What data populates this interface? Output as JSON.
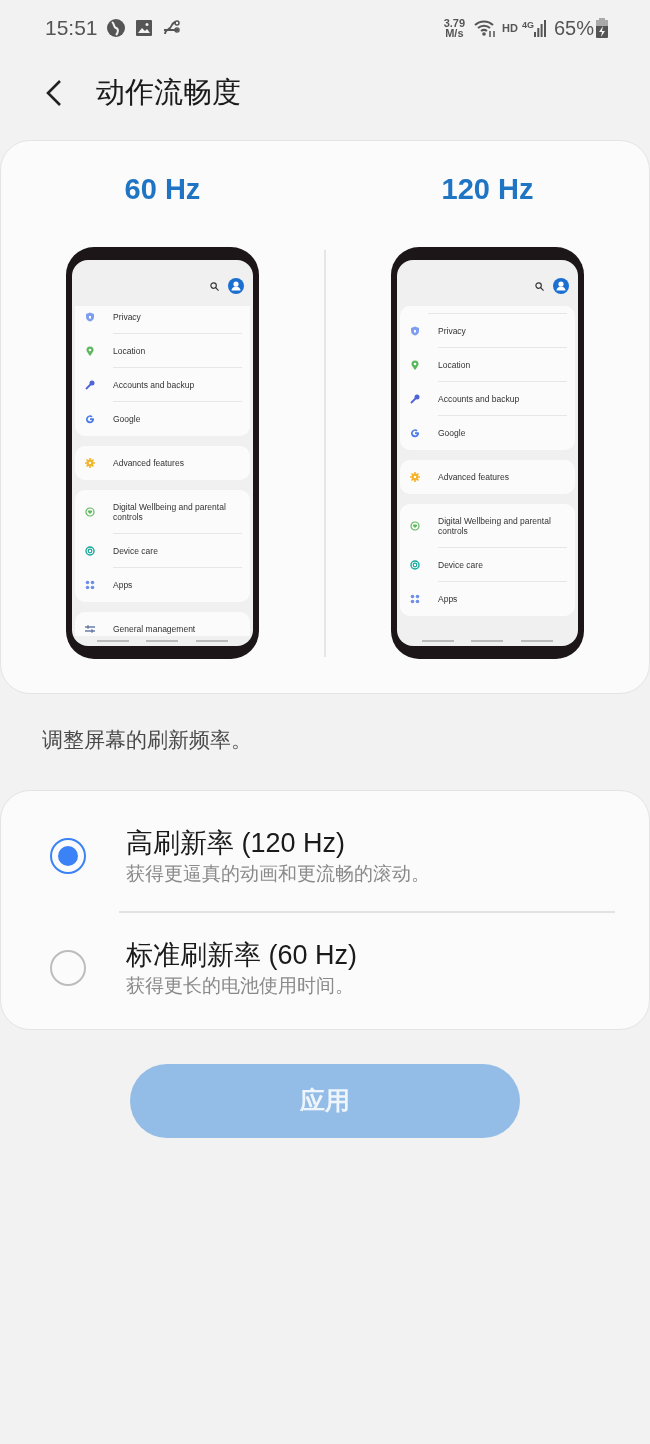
{
  "status_bar": {
    "time": "15:51",
    "speed_value": "3.79",
    "speed_unit": "M/s",
    "hd": "HD",
    "network": "4G",
    "battery": "65%"
  },
  "header": {
    "title": "动作流畅度"
  },
  "previews": [
    {
      "label": "60 Hz",
      "scrolled": true,
      "groups": [
        [
          {
            "kind": "shield",
            "text": "Privacy"
          },
          {
            "kind": "pin",
            "text": "Location"
          },
          {
            "kind": "key",
            "text": "Accounts and backup"
          },
          {
            "kind": "google",
            "text": "Google"
          }
        ],
        [
          {
            "kind": "gear",
            "text": "Advanced features"
          }
        ],
        [
          {
            "kind": "heart",
            "text": "Digital Wellbeing and parental controls"
          },
          {
            "kind": "care",
            "text": "Device care"
          },
          {
            "kind": "apps",
            "text": "Apps"
          }
        ],
        [
          {
            "kind": "sliders",
            "text": "General management"
          }
        ]
      ]
    },
    {
      "label": "120 Hz",
      "scrolled": false,
      "groups": [
        [
          {
            "kind": "shield",
            "text": "Privacy"
          },
          {
            "kind": "pin",
            "text": "Location"
          },
          {
            "kind": "key",
            "text": "Accounts and backup"
          },
          {
            "kind": "google",
            "text": "Google"
          }
        ],
        [
          {
            "kind": "gear",
            "text": "Advanced features"
          }
        ],
        [
          {
            "kind": "heart",
            "text": "Digital Wellbeing and parental controls"
          },
          {
            "kind": "care",
            "text": "Device care"
          },
          {
            "kind": "apps",
            "text": "Apps"
          }
        ]
      ]
    }
  ],
  "description": "调整屏幕的刷新频率。",
  "options": [
    {
      "title": "高刷新率 (120 Hz)",
      "subtitle": "获得更逼真的动画和更流畅的滚动。",
      "selected": true
    },
    {
      "title": "标准刷新率 (60 Hz)",
      "subtitle": "获得更长的电池使用时间。",
      "selected": false
    }
  ],
  "apply_button": {
    "label": "应用",
    "disabled": true
  }
}
